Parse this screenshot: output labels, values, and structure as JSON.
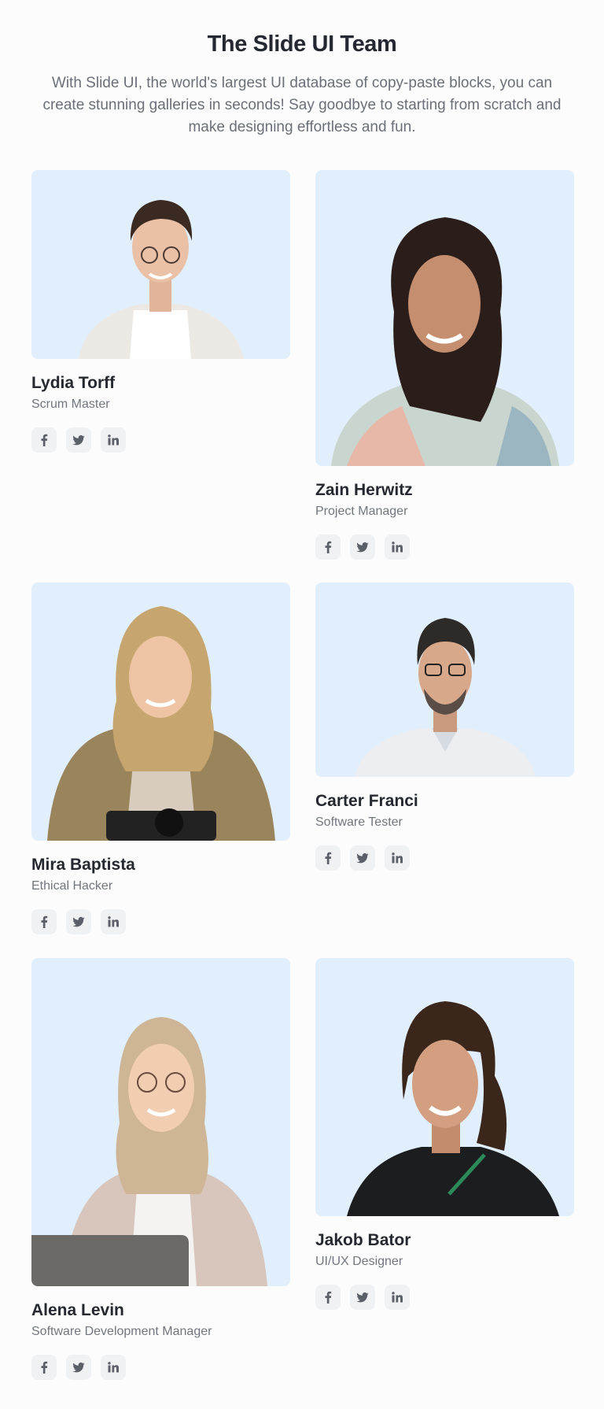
{
  "header": {
    "title": "The Slide UI Team",
    "subtitle": "With Slide UI, the world's largest UI database of copy-paste blocks, you can create stunning galleries in seconds! Say goodbye to starting from scratch and make designing effortless and fun."
  },
  "team": [
    {
      "name": "Lydia Torff",
      "role": "Scrum Master"
    },
    {
      "name": "Zain Herwitz",
      "role": "Project Manager"
    },
    {
      "name": "Mira Baptista",
      "role": "Ethical Hacker"
    },
    {
      "name": "Carter Franci",
      "role": "Software Tester"
    },
    {
      "name": "Alena Levin",
      "role": "Software Development Manager"
    },
    {
      "name": "Jakob Bator",
      "role": "UI/UX Designer"
    }
  ],
  "social_icons": [
    "facebook-icon",
    "twitter-icon",
    "linkedin-icon"
  ],
  "colors": {
    "photo_bg": "#e1effd",
    "icon_bg": "#f0f1f3",
    "icon_fg": "#5b5f68",
    "title": "#252830",
    "muted": "#6b6f78"
  }
}
